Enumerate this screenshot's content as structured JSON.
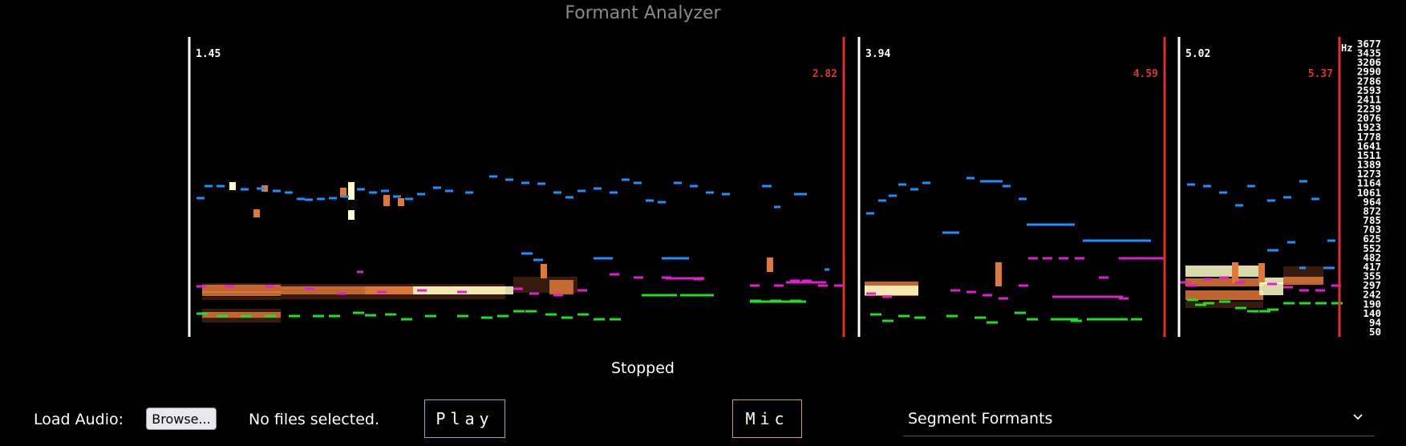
{
  "app": {
    "title": "Formant Analyzer"
  },
  "spectrogram": {
    "segments": [
      {
        "start": "1.45",
        "end": "2.82"
      },
      {
        "start": "3.94",
        "end": "4.59"
      },
      {
        "start": "5.02",
        "end": "5.37"
      }
    ],
    "freq_unit": "Hz",
    "freq_ticks": [
      "3677",
      "3435",
      "3206",
      "2990",
      "2786",
      "2593",
      "2411",
      "2239",
      "2076",
      "1923",
      "1778",
      "1641",
      "1511",
      "1389",
      "1273",
      "1164",
      "1061",
      "964",
      "872",
      "785",
      "703",
      "625",
      "552",
      "482",
      "417",
      "355",
      "297",
      "242",
      "190",
      "140",
      "94",
      "50"
    ],
    "colors": {
      "start_marker": "#ffffff",
      "end_marker": "#e03030",
      "f1": "#22dd22",
      "f2": "#e020d0",
      "f3": "#1e90ff",
      "energy_high": "#ffffc8",
      "energy_mid": "#e07838",
      "energy_low": "#402010"
    }
  },
  "status": "Stopped",
  "controls": {
    "load_audio_label": "Load Audio:",
    "browse_label": "Browse...",
    "file_status": "No files selected.",
    "play_label": "Play",
    "mic_label": "Mic",
    "mode_select": {
      "value": "Segment Formants",
      "icon": "chevron-down-icon"
    },
    "colors": {
      "play_border": "#6fb0d8",
      "mic_border": "#d8a030"
    }
  }
}
